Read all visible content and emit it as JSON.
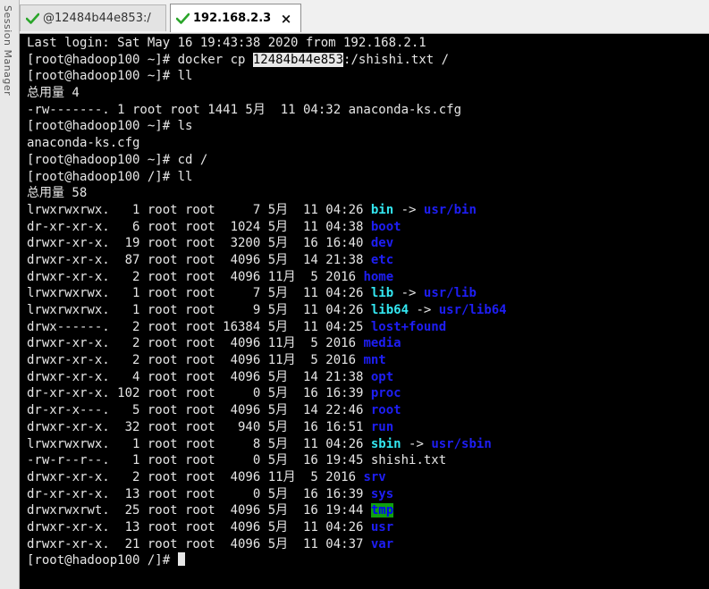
{
  "session_manager_label": "Session Manager",
  "tabs": [
    {
      "label": "@12484b44e853:/",
      "active": false
    },
    {
      "label": "192.168.2.3",
      "active": true,
      "close": "×"
    }
  ],
  "colors": {
    "check": "#2aa52a",
    "link": "#33e6f0",
    "dir": "#1e1ef5",
    "tmp_bg": "#10a010"
  },
  "terminal": {
    "login": "Last login: Sat May 16 19:43:38 2020 from 192.168.2.1",
    "cmd1_pre": "[root@hadoop100 ~]# docker cp ",
    "cmd1_sel": "12484b44e853",
    "cmd1_post": ":/shishi.txt /",
    "cmd2": "[root@hadoop100 ~]# ll",
    "total1": "总用量 4",
    "file1": "-rw-------. 1 root root 1441 5月  11 04:32 anaconda-ks.cfg",
    "cmd3": "[root@hadoop100 ~]# ls",
    "ls_out": "anaconda-ks.cfg",
    "cmd4": "[root@hadoop100 ~]# cd /",
    "cmd5": "[root@hadoop100 /]# ll",
    "total2": "总用量 58",
    "entries": [
      {
        "meta": "lrwxrwxrwx.   1 root root     7 5月  11 04:26 ",
        "name": "bin",
        "style": "link",
        "arrow": " -> ",
        "target": "usr/bin"
      },
      {
        "meta": "dr-xr-xr-x.   6 root root  1024 5月  11 04:38 ",
        "name": "boot",
        "style": "dir"
      },
      {
        "meta": "drwxr-xr-x.  19 root root  3200 5月  16 16:40 ",
        "name": "dev",
        "style": "dir"
      },
      {
        "meta": "drwxr-xr-x.  87 root root  4096 5月  14 21:38 ",
        "name": "etc",
        "style": "dir"
      },
      {
        "meta": "drwxr-xr-x.   2 root root  4096 11月  5 2016 ",
        "name": "home",
        "style": "dir"
      },
      {
        "meta": "lrwxrwxrwx.   1 root root     7 5月  11 04:26 ",
        "name": "lib",
        "style": "link",
        "arrow": " -> ",
        "target": "usr/lib"
      },
      {
        "meta": "lrwxrwxrwx.   1 root root     9 5月  11 04:26 ",
        "name": "lib64",
        "style": "link",
        "arrow": " -> ",
        "target": "usr/lib64"
      },
      {
        "meta": "drwx------.   2 root root 16384 5月  11 04:25 ",
        "name": "lost+found",
        "style": "dir"
      },
      {
        "meta": "drwxr-xr-x.   2 root root  4096 11月  5 2016 ",
        "name": "media",
        "style": "dir"
      },
      {
        "meta": "drwxr-xr-x.   2 root root  4096 11月  5 2016 ",
        "name": "mnt",
        "style": "dir"
      },
      {
        "meta": "drwxr-xr-x.   4 root root  4096 5月  14 21:38 ",
        "name": "opt",
        "style": "dir"
      },
      {
        "meta": "dr-xr-xr-x. 102 root root     0 5月  16 16:39 ",
        "name": "proc",
        "style": "dir"
      },
      {
        "meta": "dr-xr-x---.   5 root root  4096 5月  14 22:46 ",
        "name": "root",
        "style": "dir"
      },
      {
        "meta": "drwxr-xr-x.  32 root root   940 5月  16 16:51 ",
        "name": "run",
        "style": "dir"
      },
      {
        "meta": "lrwxrwxrwx.   1 root root     8 5月  11 04:26 ",
        "name": "sbin",
        "style": "link",
        "arrow": " -> ",
        "target": "usr/sbin"
      },
      {
        "meta": "-rw-r--r--.   1 root root     0 5月  16 19:45 ",
        "name": "shishi.txt",
        "style": "plain"
      },
      {
        "meta": "drwxr-xr-x.   2 root root  4096 11月  5 2016 ",
        "name": "srv",
        "style": "dir"
      },
      {
        "meta": "dr-xr-xr-x.  13 root root     0 5月  16 16:39 ",
        "name": "sys",
        "style": "dir"
      },
      {
        "meta": "drwxrwxrwt.  25 root root  4096 5月  16 19:44 ",
        "name": "tmp",
        "style": "tmp"
      },
      {
        "meta": "drwxr-xr-x.  13 root root  4096 5月  11 04:26 ",
        "name": "usr",
        "style": "dir"
      },
      {
        "meta": "drwxr-xr-x.  21 root root  4096 5月  11 04:37 ",
        "name": "var",
        "style": "dir"
      }
    ],
    "prompt_final": "[root@hadoop100 /]# "
  }
}
